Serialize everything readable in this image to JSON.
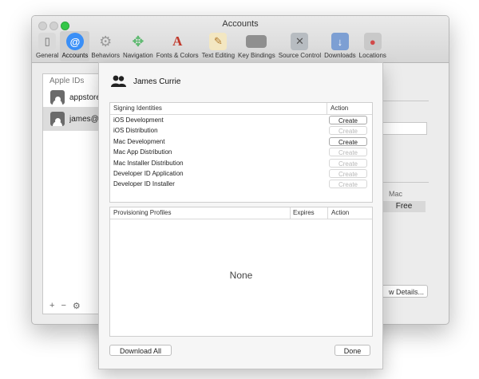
{
  "window": {
    "title": "Accounts",
    "toolbar": [
      {
        "label": "General",
        "icon": "general-icon",
        "color": "#9a9a9a"
      },
      {
        "label": "Accounts",
        "icon": "at-sign-icon",
        "color": "#3a8ff7",
        "selected": true
      },
      {
        "label": "Behaviors",
        "icon": "gear-icon",
        "color": "#a8a8a8"
      },
      {
        "label": "Navigation",
        "icon": "arrows-icon",
        "color": "#5db96f"
      },
      {
        "label": "Fonts & Colors",
        "icon": "font-icon",
        "color": "#e58a3c"
      },
      {
        "label": "Text Editing",
        "icon": "pencil-paper-icon",
        "color": "#c8a95e"
      },
      {
        "label": "Key Bindings",
        "icon": "keyboard-icon",
        "color": "#8a8a8a"
      },
      {
        "label": "Source Control",
        "icon": "source-control-icon",
        "color": "#9aa0a6"
      },
      {
        "label": "Downloads",
        "icon": "download-icon",
        "color": "#6f8fc4"
      },
      {
        "label": "Locations",
        "icon": "disk-icon",
        "color": "#d24a4a"
      }
    ]
  },
  "accounts_list": {
    "header": "Apple IDs",
    "items": [
      {
        "name": "appstore"
      },
      {
        "name": "james@"
      }
    ],
    "footer": {
      "add": "+",
      "remove": "−",
      "settings": "⚙"
    }
  },
  "right_panel": {
    "mac_label": "Mac",
    "free_label": "Free",
    "details_button": "w Details..."
  },
  "sheet": {
    "user_name": "James Currie",
    "signing_identities": {
      "header_name": "Signing Identities",
      "header_action": "Action",
      "rows": [
        {
          "name": "iOS Development",
          "action": "Create",
          "enabled": true
        },
        {
          "name": "iOS Distribution",
          "action": "Create",
          "enabled": false
        },
        {
          "name": "Mac Development",
          "action": "Create",
          "enabled": true
        },
        {
          "name": "Mac App Distribution",
          "action": "Create",
          "enabled": false
        },
        {
          "name": "Mac Installer Distribution",
          "action": "Create",
          "enabled": false
        },
        {
          "name": "Developer ID Application",
          "action": "Create",
          "enabled": false
        },
        {
          "name": "Developer ID Installer",
          "action": "Create",
          "enabled": false
        }
      ]
    },
    "provisioning_profiles": {
      "header_name": "Provisioning Profiles",
      "header_expires": "Expires",
      "header_action": "Action",
      "empty_text": "None"
    },
    "download_all_button": "Download All",
    "done_button": "Done"
  }
}
